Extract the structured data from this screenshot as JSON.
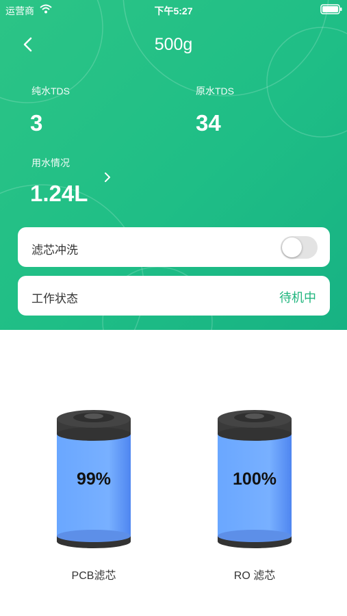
{
  "status_bar": {
    "carrier": "运营商",
    "time": "下午5:27"
  },
  "nav": {
    "title": "500g"
  },
  "metrics": {
    "pure_tds": {
      "label": "纯水TDS",
      "value": "3"
    },
    "raw_tds": {
      "label": "原水TDS",
      "value": "34"
    },
    "usage": {
      "label": "用水情况",
      "value": "1.24L"
    }
  },
  "flush_card": {
    "label": "滤芯冲洗",
    "enabled": false
  },
  "work_card": {
    "label": "工作状态",
    "value": "待机中"
  },
  "filters": [
    {
      "name": "PCB滤芯",
      "percent_text": "99%",
      "percent": 99
    },
    {
      "name": "RO 滤芯",
      "percent_text": "100%",
      "percent": 100
    }
  ],
  "colors": {
    "primary": "#1fbe86",
    "status_text": "#1fb57d",
    "filter_body": "#6ea6ff"
  },
  "icons": [
    "wifi-icon",
    "battery-icon",
    "back-chevron-icon",
    "chevron-right-icon"
  ]
}
